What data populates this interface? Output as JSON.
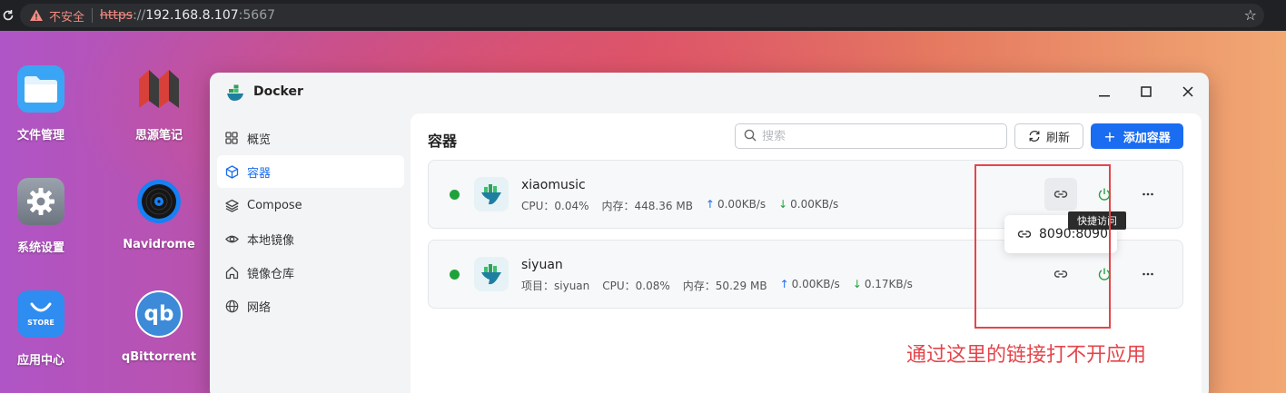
{
  "browser": {
    "insecure_label": "不安全",
    "url_scheme": "https",
    "url_sep": "://",
    "url_host": "192.168.8.107",
    "url_port": ":5667"
  },
  "desktop": {
    "icons": [
      {
        "label": "文件管理",
        "icon": "folder-icon"
      },
      {
        "label": "思源笔记",
        "icon": "siyuan-icon"
      },
      {
        "label": "系统设置",
        "icon": "gear-icon"
      },
      {
        "label": "Navidrome",
        "icon": "vinyl-icon"
      },
      {
        "label": "应用中心",
        "icon": "store-icon",
        "badge": "STORE"
      },
      {
        "label": "qBittorrent",
        "icon": "qbittorrent-icon",
        "badge": "qb"
      }
    ]
  },
  "window": {
    "title": "Docker",
    "sidebar": [
      {
        "label": "概览",
        "icon": "grid-icon"
      },
      {
        "label": "容器",
        "icon": "cube-icon",
        "active": true
      },
      {
        "label": "Compose",
        "icon": "layers-icon"
      },
      {
        "label": "本地镜像",
        "icon": "eye-icon"
      },
      {
        "label": "镜像仓库",
        "icon": "house-icon"
      },
      {
        "label": "网络",
        "icon": "globe-icon"
      }
    ],
    "main": {
      "title": "容器",
      "search_placeholder": "搜索",
      "refresh_label": "刷新",
      "add_label": "添加容器",
      "containers": [
        {
          "name": "xiaomusic",
          "status": "running",
          "cpu": "CPU：0.04%",
          "mem": "内存：448.36 MB",
          "up": "0.00KB/s",
          "down": "0.00KB/s"
        },
        {
          "name": "siyuan",
          "status": "running",
          "project": "项目：siyuan",
          "cpu": "CPU：0.08%",
          "mem": "内存：50.29 MB",
          "up": "0.00KB/s",
          "down": "0.17KB/s"
        }
      ]
    },
    "tooltip": "快捷访问",
    "popover_port": "8090:8090"
  },
  "annotation": {
    "text": "通过这里的链接打不开应用",
    "color": "#e4454b"
  },
  "colors": {
    "accent": "#1a6cf0",
    "running": "#1fa23a"
  }
}
